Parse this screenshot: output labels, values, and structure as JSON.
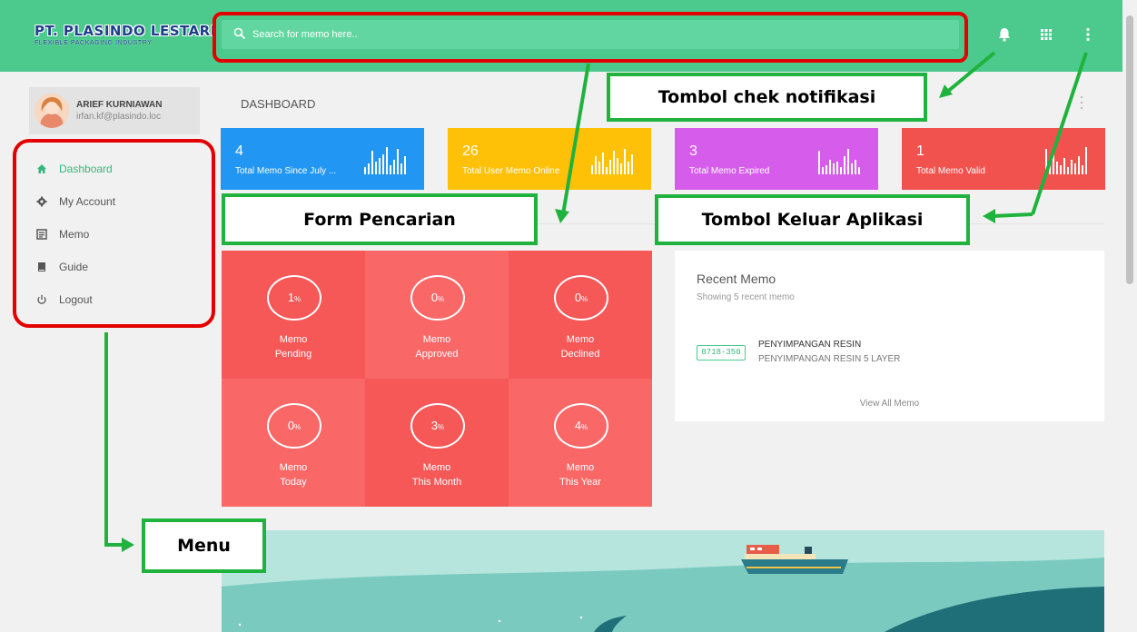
{
  "app": {
    "brand_title": "PT. PLASINDO LESTARI",
    "brand_subtitle": "FLEXIBLE PACKAGING INDUSTRY",
    "accent_color": "#4cca8d"
  },
  "search": {
    "placeholder": "Search for memo here.."
  },
  "topbar_icons": [
    "bell-icon",
    "apps-grid-icon",
    "more-vert-icon"
  ],
  "user": {
    "name": "ARIEF KURNIAWAN",
    "email": "irfan.kf@plasindo.loc"
  },
  "sidebar": {
    "items": [
      {
        "label": "Dashboard",
        "icon": "home-icon",
        "active": true
      },
      {
        "label": "My Account",
        "icon": "gear-icon",
        "active": false
      },
      {
        "label": "Memo",
        "icon": "memo-icon",
        "active": false
      },
      {
        "label": "Guide",
        "icon": "book-icon",
        "active": false
      },
      {
        "label": "Logout",
        "icon": "power-icon",
        "active": false
      }
    ]
  },
  "page": {
    "title": "DASHBOARD"
  },
  "stats": [
    {
      "value": "4",
      "label": "Total Memo Since July ...",
      "color": "#2196f3"
    },
    {
      "value": "26",
      "label": "Total User Memo Online",
      "color": "#ffc107"
    },
    {
      "value": "3",
      "label": "Total Memo Expired",
      "color": "#d65cec"
    },
    {
      "value": "1",
      "label": "Total Memo Valid",
      "color": "#f2524e"
    }
  ],
  "progress": [
    {
      "value": "1",
      "unit": "%",
      "line1": "Memo",
      "line2": "Pending"
    },
    {
      "value": "0",
      "unit": "%",
      "line1": "Memo",
      "line2": "Approved"
    },
    {
      "value": "0",
      "unit": "%",
      "line1": "Memo",
      "line2": "Declined"
    },
    {
      "value": "0",
      "unit": "%",
      "line1": "Memo",
      "line2": "Today"
    },
    {
      "value": "3",
      "unit": "%",
      "line1": "Memo",
      "line2": "This Month"
    },
    {
      "value": "4",
      "unit": "%",
      "line1": "Memo",
      "line2": "This Year"
    }
  ],
  "recent": {
    "title": "Recent Memo",
    "subtitle": "Showing 5 recent memo",
    "items": [
      {
        "code": "0718-350",
        "title": "PENYIMPANGAN RESIN",
        "desc": "PENYIMPANGAN RESIN 5 LAYER"
      }
    ],
    "view_all": "View All Memo"
  },
  "annotations": {
    "notif": "Tombol chek notifikasi",
    "search": "Form Pencarian",
    "logout": "Tombol Keluar Aplikasi",
    "menu": "Menu"
  }
}
